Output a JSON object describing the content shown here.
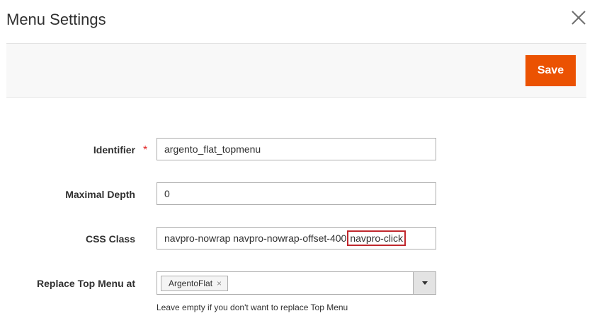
{
  "modal": {
    "title": "Menu Settings",
    "close_icon": "close-icon"
  },
  "toolbar": {
    "save_label": "Save",
    "save_color": "#eb5202"
  },
  "form": {
    "identifier": {
      "label": "Identifier",
      "required_mark": "*",
      "value": "argento_flat_topmenu"
    },
    "maximal_depth": {
      "label": "Maximal Depth",
      "value": "0"
    },
    "css_class": {
      "label": "CSS Class",
      "value_prefix": "navpro-nowrap navpro-nowrap-offset-400",
      "value_highlighted": "navpro-click",
      "highlight_color": "#c0272d"
    },
    "replace_top_menu": {
      "label": "Replace Top Menu at",
      "selected_tags": [
        "ArgentoFlat"
      ],
      "remove_glyph": "×",
      "dropdown_icon": "chevron-down-icon",
      "note": "Leave empty if you don't want to replace Top Menu"
    }
  },
  "colors": {
    "required": "#e22626",
    "text": "#303030",
    "border": "#adadad",
    "toolbar_bg": "#f8f8f8"
  }
}
